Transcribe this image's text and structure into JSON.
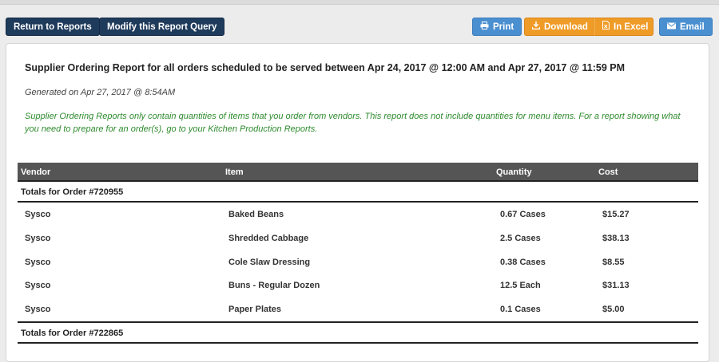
{
  "toolbar": {
    "return_label": "Return to Reports",
    "modify_label": "Modify this Report Query",
    "print_label": "Print",
    "download_label": "Download",
    "excel_label": "In Excel",
    "email_label": "Email"
  },
  "report": {
    "title": "Supplier Ordering Report for all orders scheduled to be served between Apr 24, 2017 @ 12:00 AM and Apr 27, 2017 @ 11:59 PM",
    "generated": "Generated on Apr 27, 2017 @ 8:54AM",
    "note": "Supplier Ordering Reports only contain quantities of items that you order from vendors. This report does not include quantities for menu items. For a report showing what you need to prepare for an order(s), go to your Kitchen Production Reports."
  },
  "table": {
    "headers": [
      "Vendor",
      "Item",
      "Quantity",
      "Cost"
    ],
    "orders": [
      {
        "label": "Totals for Order #720955",
        "rows": [
          [
            "Sysco",
            "Baked Beans",
            "0.67 Cases",
            "$15.27"
          ],
          [
            "Sysco",
            "Shredded Cabbage",
            "2.5 Cases",
            "$38.13"
          ],
          [
            "Sysco",
            "Cole Slaw Dressing",
            "0.38 Cases",
            "$8.55"
          ],
          [
            "Sysco",
            "Buns - Regular Dozen",
            "12.5 Each",
            "$31.13"
          ],
          [
            "Sysco",
            "Paper Plates",
            "0.1 Cases",
            "$5.00"
          ]
        ]
      },
      {
        "label": "Totals for Order #722865",
        "rows": []
      }
    ]
  }
}
